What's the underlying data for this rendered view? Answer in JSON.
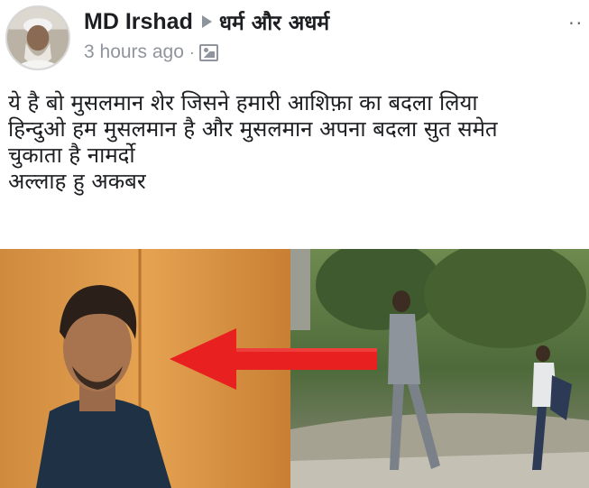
{
  "post": {
    "author": {
      "name": "MD Irshad",
      "avatar_icon": "profile-photo-icon"
    },
    "separator_icon": "arrow-right-icon",
    "group": {
      "name": "धर्म और अधर्म"
    },
    "timestamp": "3 hours ago",
    "dot": "·",
    "privacy_icon": "photo-icon",
    "more_options": "··",
    "text": "ये है बो मुसलमान शेर जिसने हमारी आशिफ़ा का बदला लिया\nहिन्दुओ हम मुसलमान है और मुसलमान अपना बदला सुत समेत\nचुकाता है नामर्दो\nअल्लाह हु अकबर",
    "image": {
      "description_icon": "post-photo-icon",
      "arrow_color": "#e8201f"
    }
  },
  "colors": {
    "text": "#1c1e21",
    "secondary": "#90949c",
    "arrow_red": "#e8201f"
  }
}
